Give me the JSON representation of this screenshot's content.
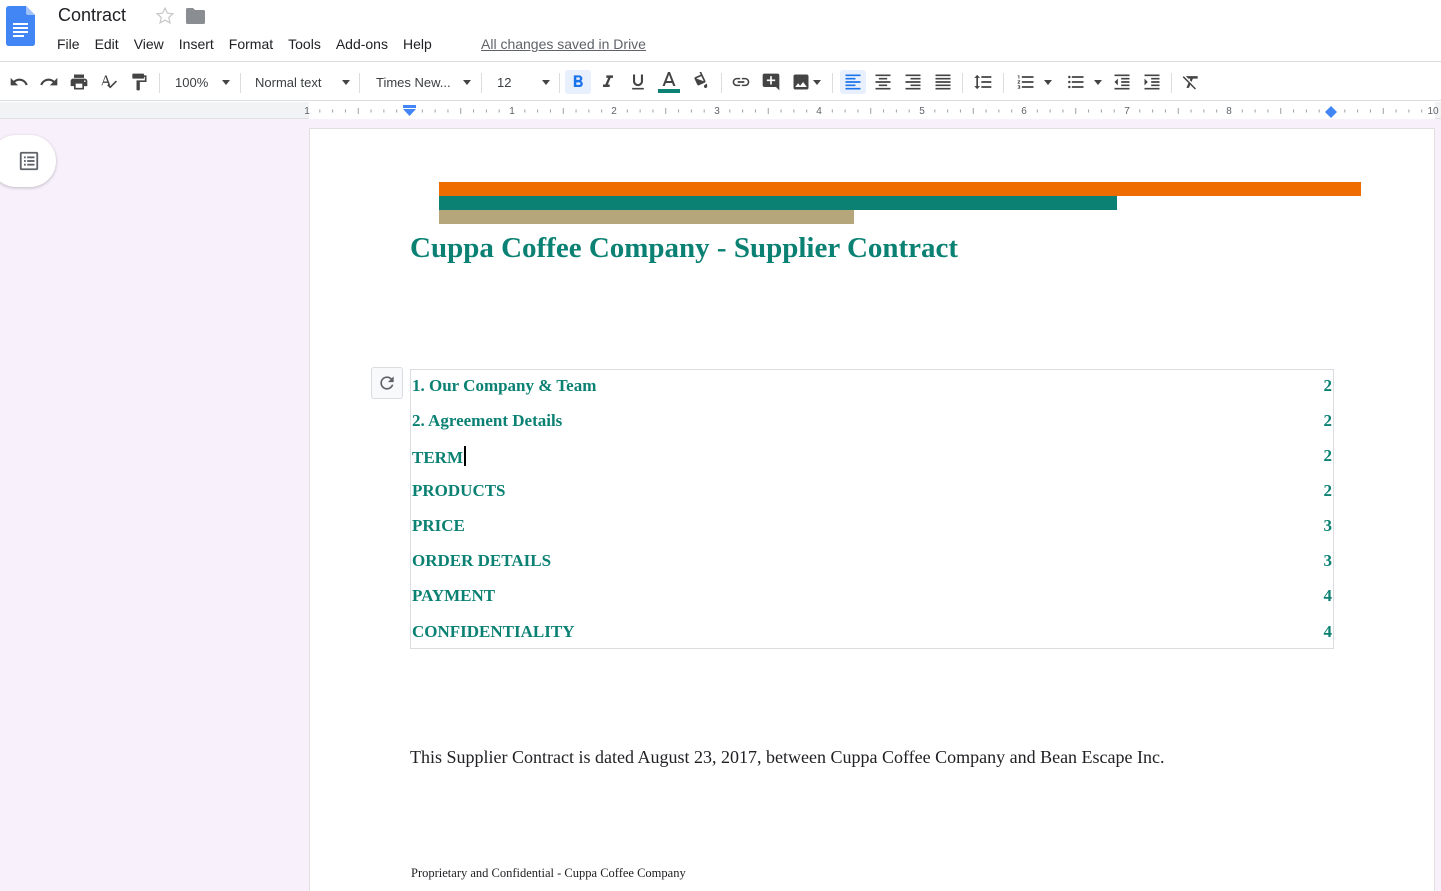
{
  "app": {
    "doc_title": "Contract",
    "menu": [
      "File",
      "Edit",
      "View",
      "Insert",
      "Format",
      "Tools",
      "Add-ons",
      "Help"
    ],
    "save_status": "All changes saved in Drive"
  },
  "toolbar": {
    "zoom": "100%",
    "style": "Normal text",
    "font": "Times New...",
    "font_size": "12",
    "icons": [
      "undo-icon",
      "redo-icon",
      "print-icon",
      "spellcheck-icon",
      "paint-format-icon",
      "bold-icon",
      "italic-icon",
      "underline-icon",
      "text-color-icon",
      "highlight-icon",
      "link-icon",
      "comment-icon",
      "image-icon",
      "align-left-icon",
      "align-center-icon",
      "align-right-icon",
      "justify-icon",
      "line-spacing-icon",
      "numbered-list-icon",
      "bulleted-list-icon",
      "decrease-indent-icon",
      "increase-indent-icon",
      "clear-formatting-icon"
    ],
    "bold_active": true,
    "align_left_active": true,
    "text_color": "#0b8173"
  },
  "ruler": {
    "labels": [
      "1",
      "1",
      "2",
      "3",
      "4",
      "5",
      "6",
      "7",
      "8",
      "10"
    ]
  },
  "document": {
    "heading": "Cuppa Coffee Company - Supplier Contract",
    "accent_colors": [
      "#ef6c00",
      "#0b8173",
      "#b5a67c"
    ],
    "toc": [
      {
        "label": "1. Our Company & Team",
        "page": "2"
      },
      {
        "label": "2. Agreement Details",
        "page": "2"
      },
      {
        "label": "TERM",
        "page": "2"
      },
      {
        "label": "PRODUCTS",
        "page": "2"
      },
      {
        "label": "PRICE",
        "page": "3"
      },
      {
        "label": "ORDER DETAILS",
        "page": "3"
      },
      {
        "label": "PAYMENT",
        "page": "4"
      },
      {
        "label": "CONFIDENTIALITY",
        "page": "4"
      }
    ],
    "body": "This Supplier Contract is dated August 23, 2017, between Cuppa Coffee Company and Bean Escape Inc.",
    "footer": "Proprietary and Confidential - Cuppa Coffee Company"
  }
}
